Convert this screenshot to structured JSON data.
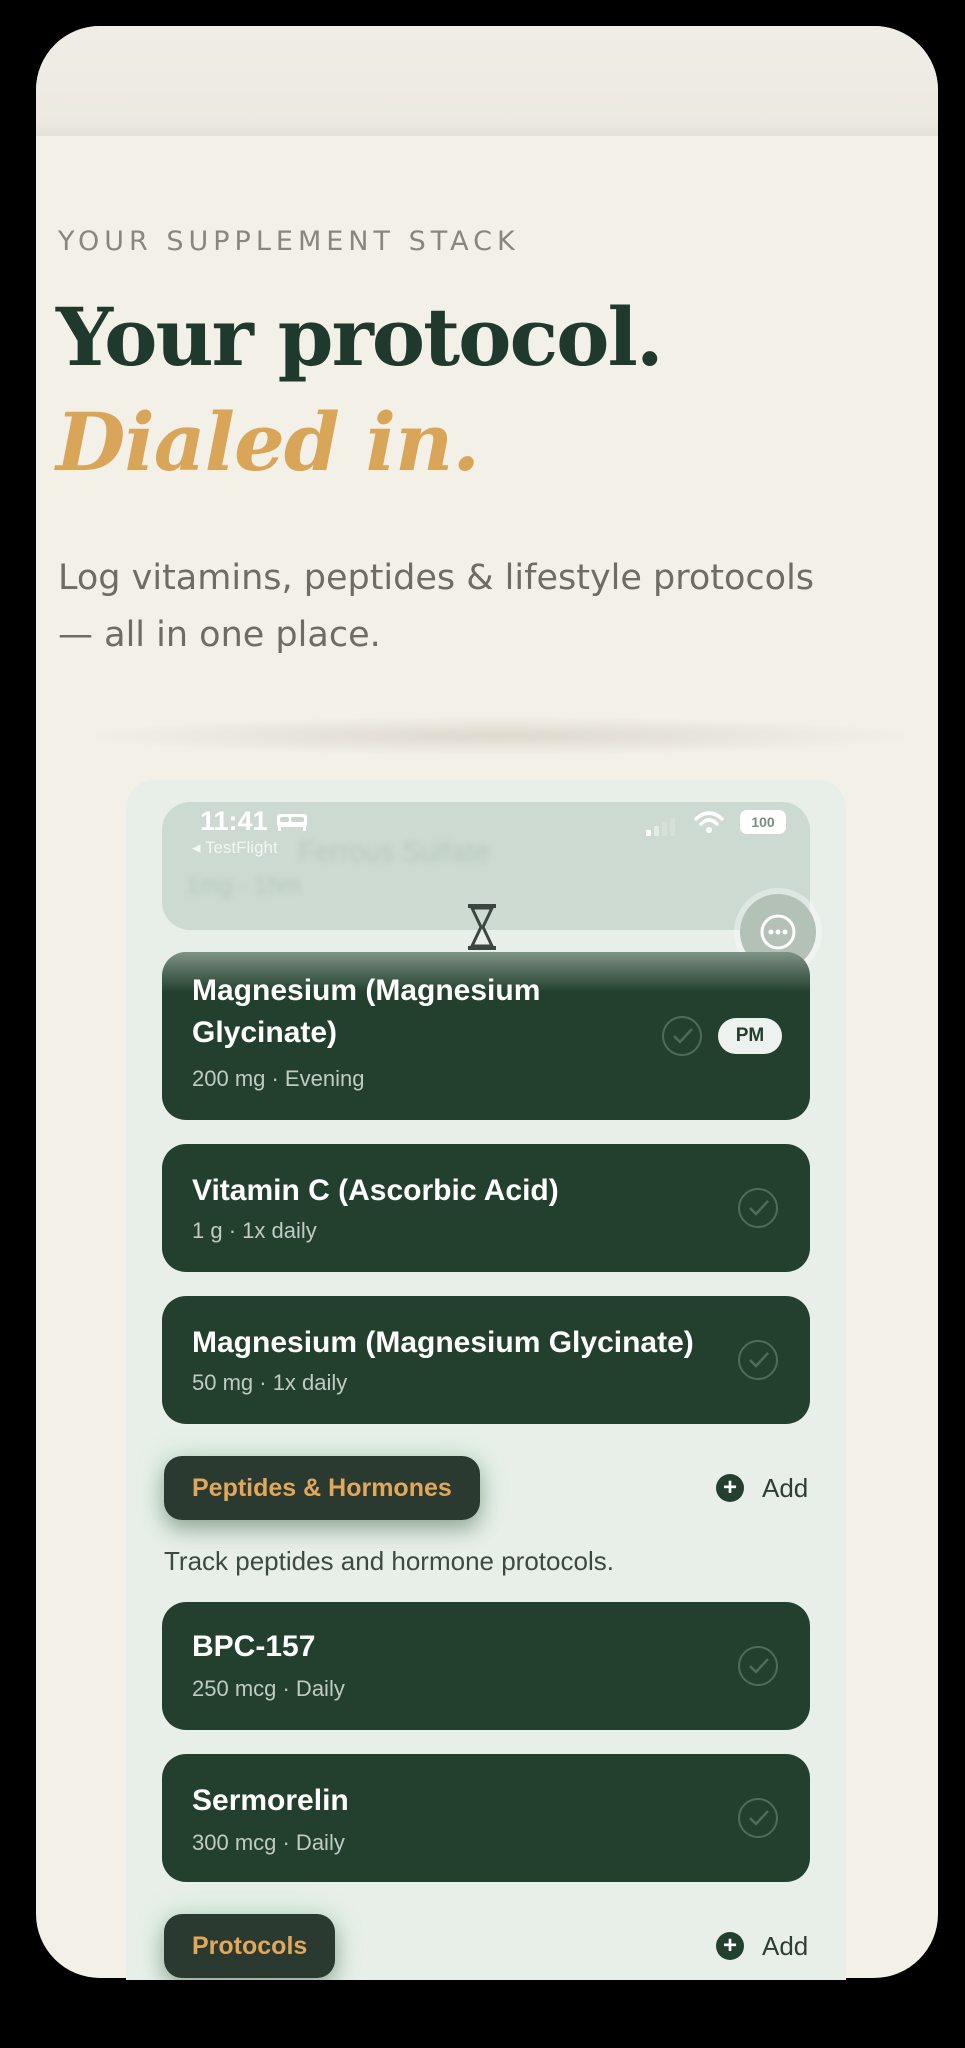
{
  "hero": {
    "eyebrow": "YOUR SUPPLEMENT STACK",
    "headline_line1": "Your protocol.",
    "headline_line2": "Dialed in.",
    "subtitle_line1": "Log vitamins, peptides & lifestyle protocols",
    "subtitle_line2": "— all in one place."
  },
  "status_bar": {
    "time": "11:41",
    "back_label": "◂ TestFlight",
    "battery": "100"
  },
  "ghost_card": {
    "name": "Ferrous Sulfate",
    "meta": "1mg · 1hm"
  },
  "supplements": [
    {
      "name_line1": "Magnesium (Magnesium",
      "name_line2": "Glycinate)",
      "meta": "200 mg · Evening",
      "badge": "PM"
    },
    {
      "name": "Vitamin C (Ascorbic Acid)",
      "meta": "1 g · 1x daily"
    },
    {
      "name": "Magnesium (Magnesium Glycinate)",
      "meta": "50 mg · 1x daily"
    }
  ],
  "peptides_section": {
    "title": "Peptides & Hormones",
    "add_label": "Add",
    "description": "Track peptides and hormone protocols."
  },
  "peptides": [
    {
      "name": "BPC-157",
      "meta": "250 mcg · Daily"
    },
    {
      "name": "Sermorelin",
      "meta": "300 mcg · Daily"
    }
  ],
  "protocols_section": {
    "title": "Protocols",
    "add_label": "Add"
  },
  "colors": {
    "card_bg": "#23402f",
    "accent_gold": "#d9a659",
    "headline_green": "#1f3a2c",
    "page_bg": "#f3f0e8"
  }
}
